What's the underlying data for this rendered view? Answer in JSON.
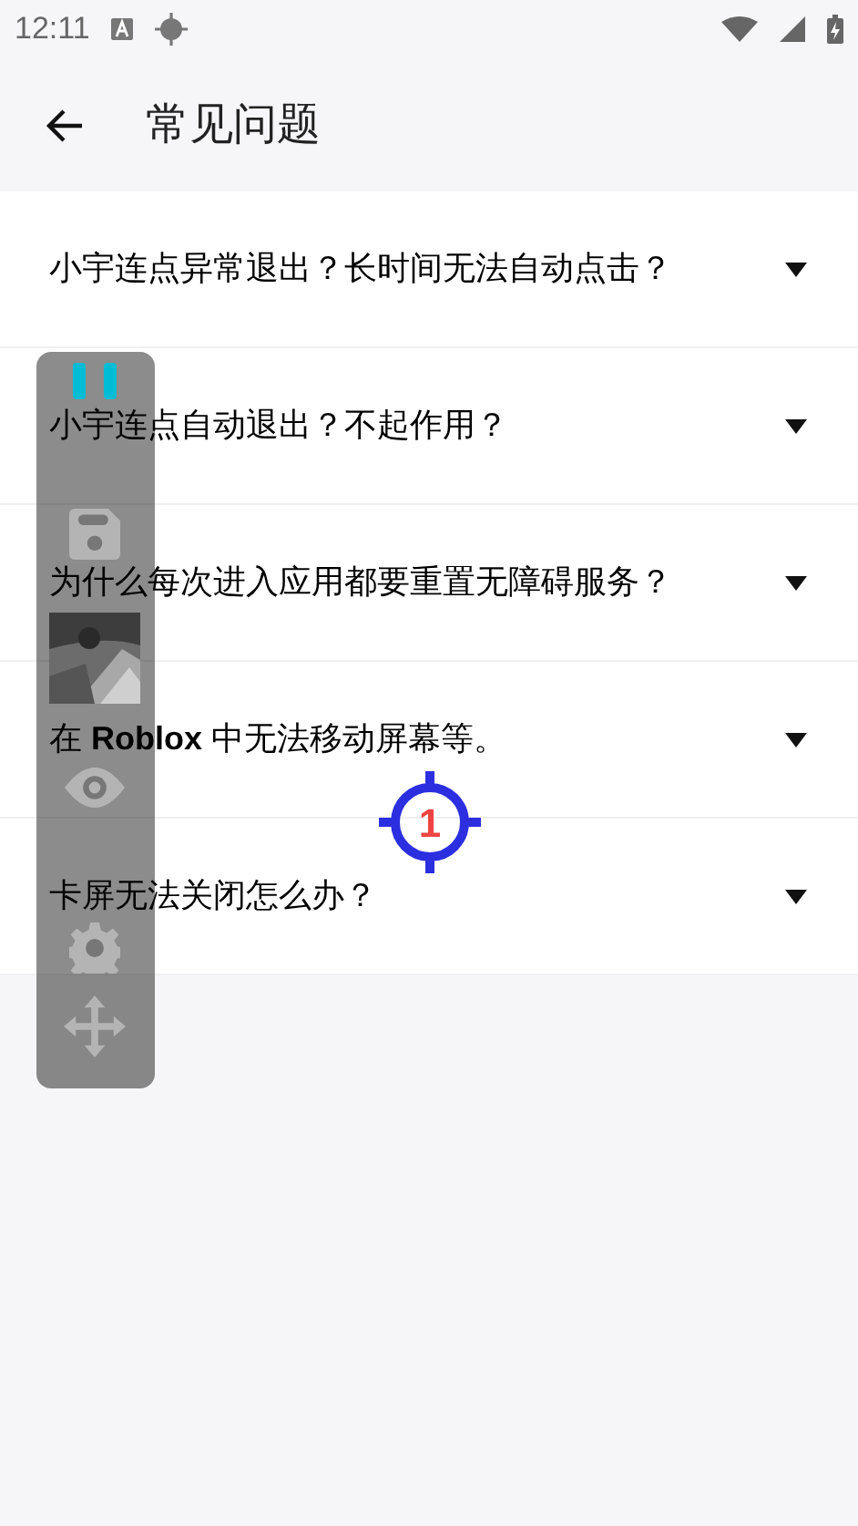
{
  "status_bar": {
    "time": "12:11"
  },
  "app_bar": {
    "title": "常见问题"
  },
  "faq": [
    {
      "question": "小宇连点异常退出？长时间无法自动点击？",
      "expanded": false
    },
    {
      "question": "小宇连点自动退出？不起作用？",
      "expanded": false
    },
    {
      "question": "为什么每次进入应用都要重置无障碍服务？",
      "expanded": false
    },
    {
      "question": "在 **Roblox** 中无法移动屏幕等。",
      "expanded": false
    },
    {
      "question": "卡屏无法关闭怎么办？",
      "expanded": false
    }
  ],
  "click_target": {
    "label": "1"
  },
  "floating_panel": {
    "items": [
      {
        "kind": "pause"
      },
      {
        "kind": "save"
      },
      {
        "kind": "picture"
      },
      {
        "kind": "eye"
      },
      {
        "kind": "settings"
      },
      {
        "kind": "move"
      }
    ]
  }
}
